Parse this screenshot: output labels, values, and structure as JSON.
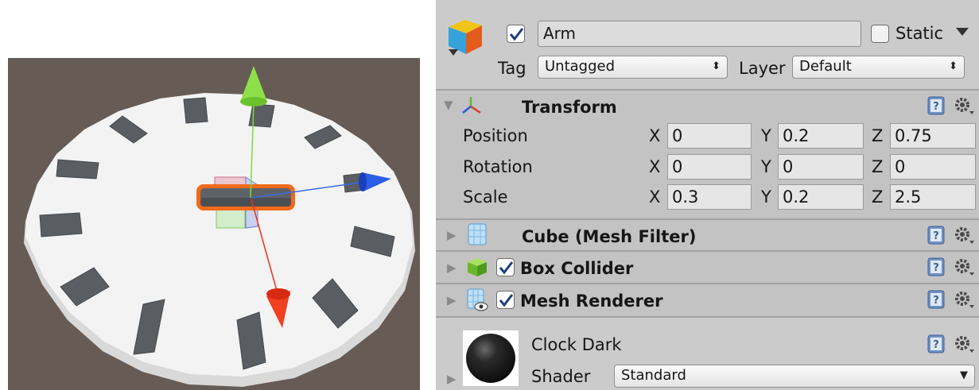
{
  "scene": {
    "background": "#665c55",
    "disk_color": "#f2f2f2",
    "marker_color": "#5c6066",
    "selection_color": "#f06a1a",
    "axis_colors": {
      "x": "#e8331c",
      "y": "#7fdb3a",
      "z": "#2255dd"
    }
  },
  "header": {
    "active": true,
    "name": "Arm",
    "static_label": "Static",
    "tag_label": "Tag",
    "tag_value": "Untagged",
    "layer_label": "Layer",
    "layer_value": "Default"
  },
  "transform": {
    "title": "Transform",
    "rows": [
      {
        "label": "Position",
        "x": "0",
        "y": "0.2",
        "z": "0.75"
      },
      {
        "label": "Rotation",
        "x": "0",
        "y": "0",
        "z": "0"
      },
      {
        "label": "Scale",
        "x": "0.3",
        "y": "0.2",
        "z": "2.5"
      }
    ],
    "axis": {
      "x": "X",
      "y": "Y",
      "z": "Z"
    }
  },
  "components": [
    {
      "title": "Cube (Mesh Filter)",
      "has_checkbox": false,
      "icon": "mesh-filter-icon"
    },
    {
      "title": "Box Collider",
      "has_checkbox": true,
      "enabled": true,
      "icon": "box-collider-icon"
    },
    {
      "title": "Mesh Renderer",
      "has_checkbox": true,
      "enabled": true,
      "icon": "mesh-renderer-icon"
    }
  ],
  "material": {
    "name": "Clock Dark",
    "shader_label": "Shader",
    "shader_value": "Standard"
  },
  "icons": {
    "help": "help-icon",
    "settings": "gear-icon",
    "fold": "triangle-fold-icon"
  }
}
